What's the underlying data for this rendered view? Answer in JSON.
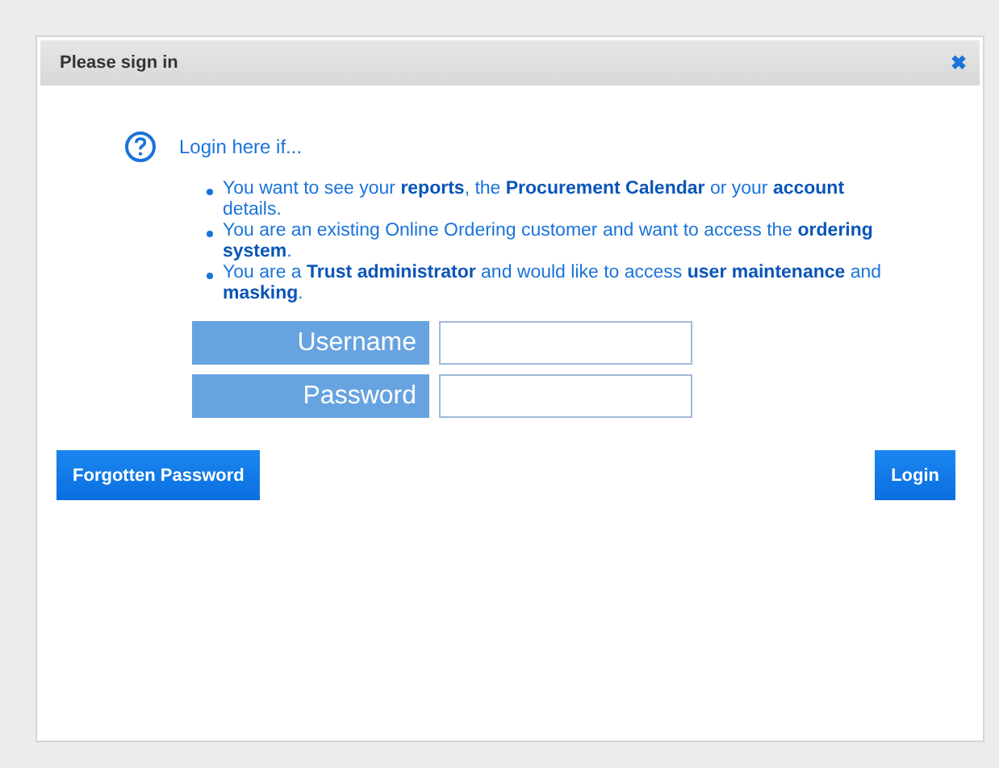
{
  "dialog": {
    "title": "Please sign in",
    "close": "✖"
  },
  "intro": "Login here if...",
  "bullets": [
    "You want to see your **reports**, the **Procurement Calendar** or your **account** details.",
    "You are an existing Online Ordering customer and want to access the **ordering system**.",
    "You are a **Trust administrator** and would like to access **user maintenance** and **masking**."
  ],
  "fields": [
    {
      "label": "Username"
    },
    {
      "label": "Password"
    }
  ],
  "buttons": {
    "forgot": "Forgotten Password",
    "login": "Login"
  }
}
